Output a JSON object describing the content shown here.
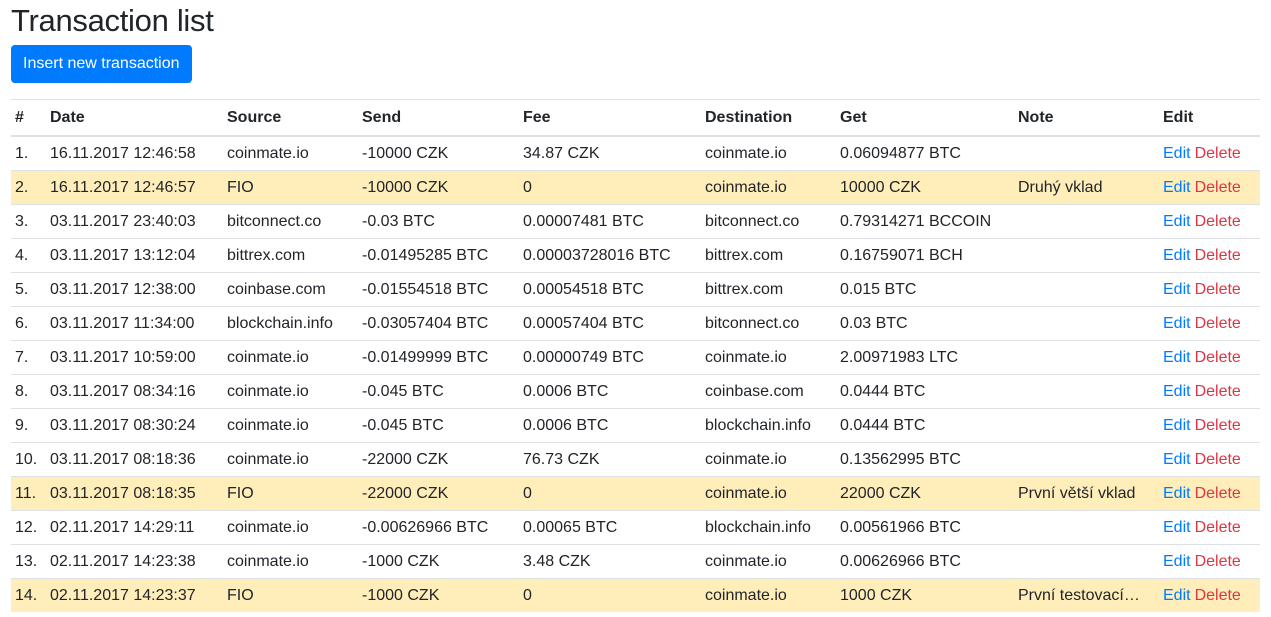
{
  "page": {
    "title": "Transaction list",
    "insert_button": "Insert new transaction"
  },
  "table": {
    "headers": {
      "num": "#",
      "date": "Date",
      "source": "Source",
      "send": "Send",
      "fee": "Fee",
      "destination": "Destination",
      "get": "Get",
      "note": "Note",
      "edit": "Edit"
    },
    "action_labels": {
      "edit": "Edit",
      "delete": "Delete"
    },
    "rows": [
      {
        "num": "1.",
        "date": "16.11.2017 12:46:58",
        "source": "coinmate.io",
        "send": "-10000 CZK",
        "fee": "34.87 CZK",
        "destination": "coinmate.io",
        "get": "0.06094877 BTC",
        "note": "",
        "highlight": false
      },
      {
        "num": "2.",
        "date": "16.11.2017 12:46:57",
        "source": "FIO",
        "send": "-10000 CZK",
        "fee": "0",
        "destination": "coinmate.io",
        "get": "10000 CZK",
        "note": "Druhý vklad",
        "highlight": true
      },
      {
        "num": "3.",
        "date": "03.11.2017 23:40:03",
        "source": "bitconnect.co",
        "send": "-0.03 BTC",
        "fee": "0.00007481 BTC",
        "destination": "bitconnect.co",
        "get": "0.79314271 BCCOIN",
        "note": "",
        "highlight": false
      },
      {
        "num": "4.",
        "date": "03.11.2017 13:12:04",
        "source": "bittrex.com",
        "send": "-0.01495285 BTC",
        "fee": "0.00003728016 BTC",
        "destination": "bittrex.com",
        "get": "0.16759071 BCH",
        "note": "",
        "highlight": false
      },
      {
        "num": "5.",
        "date": "03.11.2017 12:38:00",
        "source": "coinbase.com",
        "send": "-0.01554518 BTC",
        "fee": "0.00054518 BTC",
        "destination": "bittrex.com",
        "get": "0.015 BTC",
        "note": "",
        "highlight": false
      },
      {
        "num": "6.",
        "date": "03.11.2017 11:34:00",
        "source": "blockchain.info",
        "send": "-0.03057404 BTC",
        "fee": "0.00057404 BTC",
        "destination": "bitconnect.co",
        "get": "0.03 BTC",
        "note": "",
        "highlight": false
      },
      {
        "num": "7.",
        "date": "03.11.2017 10:59:00",
        "source": "coinmate.io",
        "send": "-0.01499999 BTC",
        "fee": "0.00000749 BTC",
        "destination": "coinmate.io",
        "get": "2.00971983 LTC",
        "note": "",
        "highlight": false
      },
      {
        "num": "8.",
        "date": "03.11.2017 08:34:16",
        "source": "coinmate.io",
        "send": "-0.045 BTC",
        "fee": "0.0006 BTC",
        "destination": "coinbase.com",
        "get": "0.0444 BTC",
        "note": "",
        "highlight": false
      },
      {
        "num": "9.",
        "date": "03.11.2017 08:30:24",
        "source": "coinmate.io",
        "send": "-0.045 BTC",
        "fee": "0.0006 BTC",
        "destination": "blockchain.info",
        "get": "0.0444 BTC",
        "note": "",
        "highlight": false
      },
      {
        "num": "10.",
        "date": "03.11.2017 08:18:36",
        "source": "coinmate.io",
        "send": "-22000 CZK",
        "fee": "76.73 CZK",
        "destination": "coinmate.io",
        "get": "0.13562995 BTC",
        "note": "",
        "highlight": false
      },
      {
        "num": "11.",
        "date": "03.11.2017 08:18:35",
        "source": "FIO",
        "send": "-22000 CZK",
        "fee": "0",
        "destination": "coinmate.io",
        "get": "22000 CZK",
        "note": "První větší vklad",
        "highlight": true
      },
      {
        "num": "12.",
        "date": "02.11.2017 14:29:11",
        "source": "coinmate.io",
        "send": "-0.00626966 BTC",
        "fee": "0.00065 BTC",
        "destination": "blockchain.info",
        "get": "0.00561966 BTC",
        "note": "",
        "highlight": false
      },
      {
        "num": "13.",
        "date": "02.11.2017 14:23:38",
        "source": "coinmate.io",
        "send": "-1000 CZK",
        "fee": "3.48 CZK",
        "destination": "coinmate.io",
        "get": "0.00626966 BTC",
        "note": "",
        "highlight": false
      },
      {
        "num": "14.",
        "date": "02.11.2017 14:23:37",
        "source": "FIO",
        "send": "-1000 CZK",
        "fee": "0",
        "destination": "coinmate.io",
        "get": "1000 CZK",
        "note": "První testovací…",
        "highlight": true
      }
    ]
  },
  "colors": {
    "primary": "#007bff",
    "danger": "#dc3545",
    "row_highlight": "#ffeeba",
    "border": "#dee2e6"
  }
}
